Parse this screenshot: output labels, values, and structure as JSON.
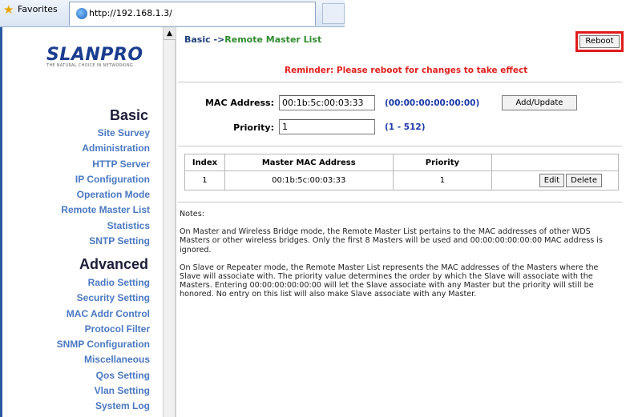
{
  "browser": {
    "favorites_label": "Favorites",
    "tab_url": "http://192.168.1.3/"
  },
  "logo": {
    "text": "SLANPRO",
    "tagline": "THE NATURAL CHOICE IN NETWORKING"
  },
  "sidebar": {
    "basic_heading": "Basic",
    "basic_items": [
      "Site Survey",
      "Administration",
      "HTTP Server",
      "IP Configuration",
      "Operation Mode",
      "Remote Master List",
      "Statistics",
      "SNTP Setting"
    ],
    "advanced_heading": "Advanced",
    "advanced_items": [
      "Radio Setting",
      "Security Setting",
      "MAC Addr Control",
      "Protocol Filter",
      "SNMP Configuration",
      "Miscellaneous",
      "Qos Setting",
      "Vlan Setting",
      "System Log"
    ]
  },
  "main": {
    "crumb_prefix": "Basic ->",
    "crumb_current": "Remote Master List",
    "reboot_label": "Reboot",
    "reminder": "Reminder: Please reboot for changes to take effect",
    "mac_label": "MAC Address:",
    "mac_value": "00:1b:5c:00:03:33",
    "mac_hint": "(00:00:00:00:00:00)",
    "add_update_label": "Add/Update",
    "priority_label": "Priority:",
    "priority_value": "1",
    "priority_hint": "(1 - 512)",
    "table": {
      "headers": [
        "Index",
        "Master MAC Address",
        "Priority",
        ""
      ],
      "rows": [
        {
          "index": "1",
          "mac": "00:1b:5c:00:03:33",
          "priority": "1",
          "edit": "Edit",
          "delete": "Delete"
        }
      ]
    },
    "notes_title": "Notes:",
    "notes": [
      "On Master and Wireless Bridge mode, the Remote Master List pertains to the MAC addresses of other WDS Masters or other wireless bridges. Only the first 8 Masters will be used and 00:00:00:00:00:00 MAC address is ignored.",
      "On Slave or Repeater mode, the Remote Master List represents the MAC addresses of the Masters where the Slave will associate with. The priority value determines the order by which the Slave will associate with the Masters. Entering 00:00:00:00:00:00 will let the Slave associate with any Master but the priority will still be honored. No entry on this list will also make Slave associate with any Master."
    ]
  },
  "colors": {
    "nav_link": "#4a78c2",
    "reminder": "#e0201e",
    "highlight_box": "#e01b1b",
    "hint": "#1d39a8"
  }
}
